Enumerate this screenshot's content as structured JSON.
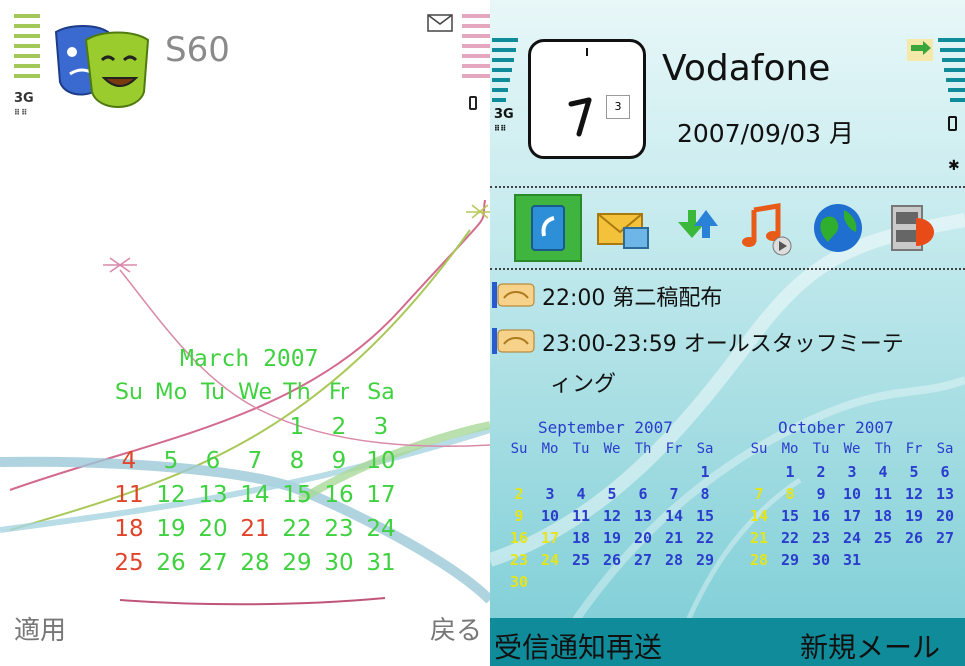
{
  "left_screen": {
    "network": "3G",
    "title": "S60",
    "calendar": {
      "title": "March 2007",
      "weekdays": [
        "Su",
        "Mo",
        "Tu",
        "We",
        "Th",
        "Fr",
        "Sa"
      ],
      "weeks": [
        [
          "",
          "",
          "",
          "",
          "1",
          "2",
          "3"
        ],
        [
          "4",
          "5",
          "6",
          "7",
          "8",
          "9",
          "10"
        ],
        [
          "11",
          "12",
          "13",
          "14",
          "15",
          "16",
          "17"
        ],
        [
          "18",
          "19",
          "20",
          "21",
          "22",
          "23",
          "24"
        ],
        [
          "25",
          "26",
          "27",
          "28",
          "29",
          "30",
          "31"
        ]
      ],
      "red_days": [
        "4",
        "11",
        "18",
        "21",
        "25"
      ]
    },
    "softkeys": {
      "left": "適用",
      "right": "戻る"
    },
    "colors": {
      "day": "#3fd13f",
      "holiday": "#e0442a"
    }
  },
  "right_screen": {
    "network": "3G",
    "clock_date_badge": "3",
    "operator": "Vodafone",
    "date": "2007/09/03 月",
    "events": [
      {
        "time_title": "22:00 第二稿配布"
      },
      {
        "time_title": "23:00-23:59 オールスタッフミーテ",
        "continuation": "ィング"
      }
    ],
    "app_icons": [
      "contacts-icon",
      "messaging-icon",
      "download-icon",
      "music-icon",
      "web-icon",
      "video-icon"
    ],
    "calendars": [
      {
        "title": "September 2007",
        "weekdays": [
          "Su",
          "Mo",
          "Tu",
          "We",
          "Th",
          "Fr",
          "Sa"
        ],
        "weeks": [
          [
            "",
            "",
            "",
            "",
            "",
            "",
            "1"
          ],
          [
            "2",
            "3",
            "4",
            "5",
            "6",
            "7",
            "8"
          ],
          [
            "9",
            "10",
            "11",
            "12",
            "13",
            "14",
            "15"
          ],
          [
            "16",
            "17",
            "18",
            "19",
            "20",
            "21",
            "22"
          ],
          [
            "23",
            "24",
            "25",
            "26",
            "27",
            "28",
            "29"
          ],
          [
            "30",
            "",
            "",
            "",
            "",
            "",
            ""
          ]
        ],
        "highlight_days": [
          "2",
          "9",
          "16",
          "17",
          "23",
          "24",
          "30"
        ]
      },
      {
        "title": "October 2007",
        "weekdays": [
          "Su",
          "Mo",
          "Tu",
          "We",
          "Th",
          "Fr",
          "Sa"
        ],
        "weeks": [
          [
            "",
            "1",
            "2",
            "3",
            "4",
            "5",
            "6"
          ],
          [
            "7",
            "8",
            "9",
            "10",
            "11",
            "12",
            "13"
          ],
          [
            "14",
            "15",
            "16",
            "17",
            "18",
            "19",
            "20"
          ],
          [
            "21",
            "22",
            "23",
            "24",
            "25",
            "26",
            "27"
          ],
          [
            "28",
            "29",
            "30",
            "31",
            "",
            "",
            ""
          ]
        ],
        "highlight_days": [
          "7",
          "8",
          "14",
          "21",
          "28"
        ]
      }
    ],
    "softkeys": {
      "left": "受信通知再送",
      "right": "新規メール"
    },
    "colors": {
      "day": "#2a3dcc",
      "highlight": "#e5e51a",
      "softbar": "#0f8b9a"
    }
  }
}
